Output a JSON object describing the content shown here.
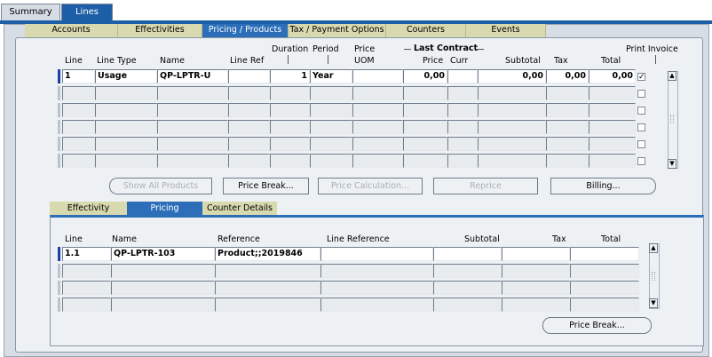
{
  "top_tabs": [
    "Summary",
    "Lines"
  ],
  "sub_tabs": [
    "Accounts",
    "Effectivities",
    "Pricing / Products",
    "Tax / Payment Options",
    "Counters",
    "Events"
  ],
  "headers": {
    "line": "Line",
    "line_type": "Line Type",
    "name": "Name",
    "line_ref": "Line Ref",
    "duration": "Duration",
    "period": "Period",
    "price_uom_1": "Price",
    "price_uom_2": "UOM",
    "last_contract": "Last Contract",
    "price": "Price",
    "curr": "Curr",
    "subtotal": "Subtotal",
    "tax": "Tax",
    "total": "Total",
    "print_invoice": "Print Invoice"
  },
  "lines": [
    {
      "line": "1",
      "line_type": "Usage",
      "name": "QP-LPTR-U",
      "line_ref": "",
      "duration": "1",
      "period": "Year",
      "price_uom": "",
      "price": "0,00",
      "curr": "",
      "subtotal": "0,00",
      "tax": "0,00",
      "total": "0,00",
      "print_invoice": "✓"
    }
  ],
  "buttons": {
    "show_all_products": "Show All Products",
    "price_break": "Price Break...",
    "price_calculation": "Price Calculation...",
    "reprice": "Reprice",
    "billing": "Billing..."
  },
  "detail_tabs": [
    "Effectivity",
    "Pricing",
    "Counter Details"
  ],
  "detail_headers": {
    "line": "Line",
    "name": "Name",
    "reference": "Reference",
    "line_reference": "Line Reference",
    "subtotal": "Subtotal",
    "tax": "Tax",
    "total": "Total"
  },
  "detail_rows": [
    {
      "line": "1.1",
      "name": "QP-LPTR-103",
      "reference": "Product;;2019846",
      "line_reference": "",
      "subtotal": "",
      "tax": "",
      "total": ""
    }
  ],
  "detail_button": "Price Break...",
  "colors": {
    "accent": "#1d5fa6",
    "panel": "#d6dde4",
    "subtab": "#d9d9b0"
  }
}
